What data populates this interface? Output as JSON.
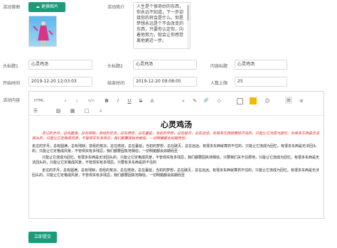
{
  "form": {
    "cover_label": "活动首图",
    "change_image_button": "更换图片",
    "intro_label": "活动简介",
    "intro_text": "人生是个很奇妙的东西，你永远不知道，下一步迎接你的将会是什么。但是梦想永远是个不会改变的东西，只要你认定你，向着他努力，就会让你感觉离他更近一步。",
    "header1_label": "头标题1",
    "header1_value": "心灵鸡汤",
    "header2_label": "头标题2",
    "header2_value": "心灵鸡汤",
    "content_title_label": "内容标题",
    "content_title_value": "心灵鸡汤",
    "start_label": "开始时间",
    "start_value": "2019-12-20 12:03:03",
    "end_label": "结束时间",
    "end_value": "2019-12-20 09:08:05",
    "limit_label": "人数上限",
    "limit_value": "25",
    "content_label": "活动内容",
    "submit_button": "立即提交"
  },
  "editor": {
    "toolbar": {
      "html": "HTML",
      "undo": "‹",
      "redo": "›",
      "code": "</>",
      "bold": "B",
      "italic": "I",
      "underline": "U",
      "strike": "S",
      "sup": "A",
      "search": "⌕",
      "brush": "✎",
      "link": "🔗",
      "eraser": "◇",
      "checkbox": "",
      "highlight": "",
      "emoji": "☺",
      "align_left": "≡",
      "align_center": "≡",
      "list": "☰",
      "image": "▨",
      "table": "▦",
      "fullscreen": "□",
      "zoom": "⌕"
    },
    "heading": "心灵鸡汤",
    "paragraph_red": "走过的岁月，总有圆满，总有残缺；曾经的荒凉，总在燃烧，总在蔓延；当初的梦想，总在破灭，总在远远。有很多东西就算抓不住的，只能让它流成为回忆。有很多东西是无法回头的，只能让它定格成风景，不管现实有多残忍，我们都要固执地相信，一切明媚都会如期而至。",
    "paragraph_2": "走过的岁月，总有圆满，总有残缺；曾经的荒凉，总在燃烧，总在蔓延；当初的梦想，总在破灭，总在远远。有很多东西就算抓不住的，只能让它流成为回忆。有很多东西是无法回头的，只能让它定格成风景，不管现实有多残忍，我们都要固执地相信，一切明媚都会如期而至",
    "paragraph_3": "只能让它流成为回忆。有很多东西是无法回头的，只能让它定格成风景，不管现实有多残忍，我们都要固执地相信，只要我们关不住那地，只能让它流成为回忆。有很多东西是无法回头的，只能让它定格成风景，不管现实有多残忍，只要有多东西是抓不住的",
    "paragraph_4": "走过的岁月，总有圆满，总有残缺；曾经的荒凉，总在燃烧，总在蔓延；当初的梦想，总在破灭，总在远远。有很多东西就算抓不住的，只能让它流成为回忆。有很多东西是无法回头的，只能让它定格成风景，不管现实有多残忍，我们都要固执地相信，一切明媚都会如期而至"
  },
  "colors": {
    "accent": "#1a9b79",
    "red_text": "#e02020",
    "highlight_swatch": "#f5b800"
  }
}
